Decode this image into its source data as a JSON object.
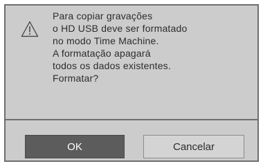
{
  "dialog": {
    "icon": "warning-icon",
    "message_lines": [
      "Para copiar gravações",
      "o HD USB deve ser formatado",
      "no modo Time Machine.",
      "A formatação apagará",
      "todos os dados existentes.",
      "Formatar?"
    ],
    "ok_label": "OK",
    "cancel_label": "Cancelar"
  },
  "colors": {
    "dialog_bg": "#cccccc",
    "ok_button_bg": "#5c5c5c",
    "cancel_button_bg": "#d4d4d4",
    "border": "#6e6e6e"
  }
}
